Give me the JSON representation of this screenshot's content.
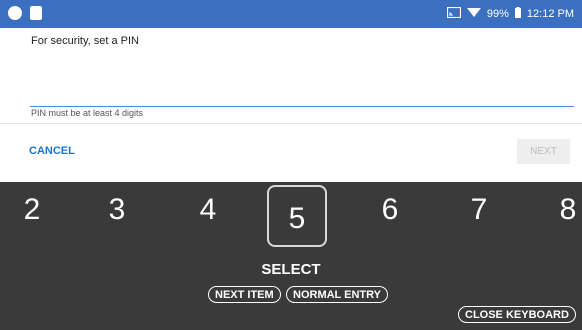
{
  "status_bar": {
    "battery": "99%",
    "time": "12:12 PM"
  },
  "form": {
    "prompt": "For security, set a PIN",
    "pin_value": "",
    "hint": "PIN must be at least 4 digits",
    "cancel_label": "CANCEL",
    "next_label": "NEXT"
  },
  "keyboard": {
    "digits": [
      "2",
      "3",
      "4",
      "5",
      "6",
      "7",
      "8"
    ],
    "selected_digit": "5",
    "select_label": "SELECT",
    "next_item_label": "NEXT ITEM",
    "normal_entry_label": "NORMAL ENTRY",
    "close_keyboard_label": "CLOSE KEYBOARD"
  },
  "colors": {
    "status_bar": "#3b6fbf",
    "accent": "#1b73d0",
    "keyboard_bg": "#3a3a3a"
  }
}
